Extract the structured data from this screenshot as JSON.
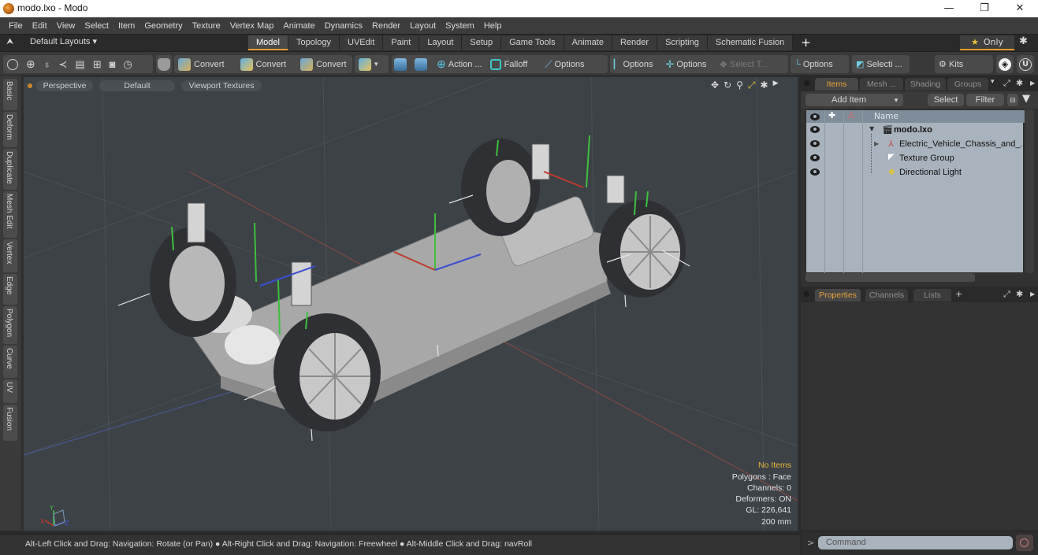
{
  "window": {
    "title": "modo.lxo - Modo",
    "minimize": "—",
    "maximize": "❐",
    "close": "✕"
  },
  "menu": [
    "File",
    "Edit",
    "View",
    "Select",
    "Item",
    "Geometry",
    "Texture",
    "Vertex Map",
    "Animate",
    "Dynamics",
    "Render",
    "Layout",
    "System",
    "Help"
  ],
  "layoutbar": {
    "layouts_label": "Default Layouts ▾",
    "tabs": [
      "Model",
      "Topology",
      "UVEdit",
      "Paint",
      "Layout",
      "Setup",
      "Game Tools",
      "Animate",
      "Render",
      "Scripting",
      "Schematic Fusion"
    ],
    "active_tab": "Model",
    "add_tab": "+",
    "only_label": "Only",
    "star": "★",
    "gear": "✱"
  },
  "toolbar": {
    "convert1": "Convert",
    "convert2": "Convert",
    "convert3": "Convert",
    "action": "Action ...",
    "falloff": "Falloff",
    "options1": "Options",
    "options2": "Options",
    "options3": "Options",
    "select_t": "Select T...",
    "options4": "Options",
    "selecti": "Selecti ...",
    "kits": "Kits"
  },
  "left_tabs": [
    "Basic",
    "Deform",
    "Duplicate",
    "Mesh Edit",
    "Vertex",
    "Edge",
    "Polygon",
    "Curve",
    "UV",
    "Fusion"
  ],
  "viewport": {
    "view": "Perspective",
    "shading": "Default",
    "textures": "Viewport Textures",
    "stats": {
      "items": "No Items",
      "polygons": "Polygons : Face",
      "channels": "Channels: 0",
      "deformers": "Deformers: ON",
      "gl": "GL: 226,641",
      "unit": "200 mm"
    },
    "axis_labels": {
      "x": "X",
      "y": "Y",
      "z": "Z"
    }
  },
  "statusbar": {
    "message": "Alt-Left Click and Drag: Navigation: Rotate (or Pan) ● Alt-Right Click and Drag: Navigation: Freewheel ● Alt-Middle Click and Drag: navRoll"
  },
  "items_panel": {
    "tabs": [
      "Items",
      "Mesh ...",
      "Shading",
      "Groups"
    ],
    "active_tab": "Items",
    "add_item": "Add Item",
    "select": "Select",
    "filter": "Filter",
    "column_name": "Name",
    "tree": [
      {
        "label": "modo.lxo",
        "level": 0,
        "expanded": true,
        "icon": "scene-icon"
      },
      {
        "label": "Electric_Vehicle_Chassis_and_...",
        "level": 1,
        "expanded": false,
        "icon": "mesh-locator-icon"
      },
      {
        "label": "Texture Group",
        "level": 1,
        "icon": "texture-group-icon"
      },
      {
        "label": "Directional Light",
        "level": 1,
        "icon": "light-icon"
      }
    ]
  },
  "properties_panel": {
    "tabs": [
      "Properties",
      "Channels",
      "Lists"
    ],
    "active_tab": "Properties",
    "add_tab": "+"
  },
  "command": {
    "prompt": ">",
    "placeholder": "Command"
  },
  "colors": {
    "accent": "#e39b2a",
    "viewport_bg": "#3d4247",
    "x_axis": "#c0392b",
    "y_axis": "#3ec03e",
    "z_axis": "#3a4fd0"
  }
}
